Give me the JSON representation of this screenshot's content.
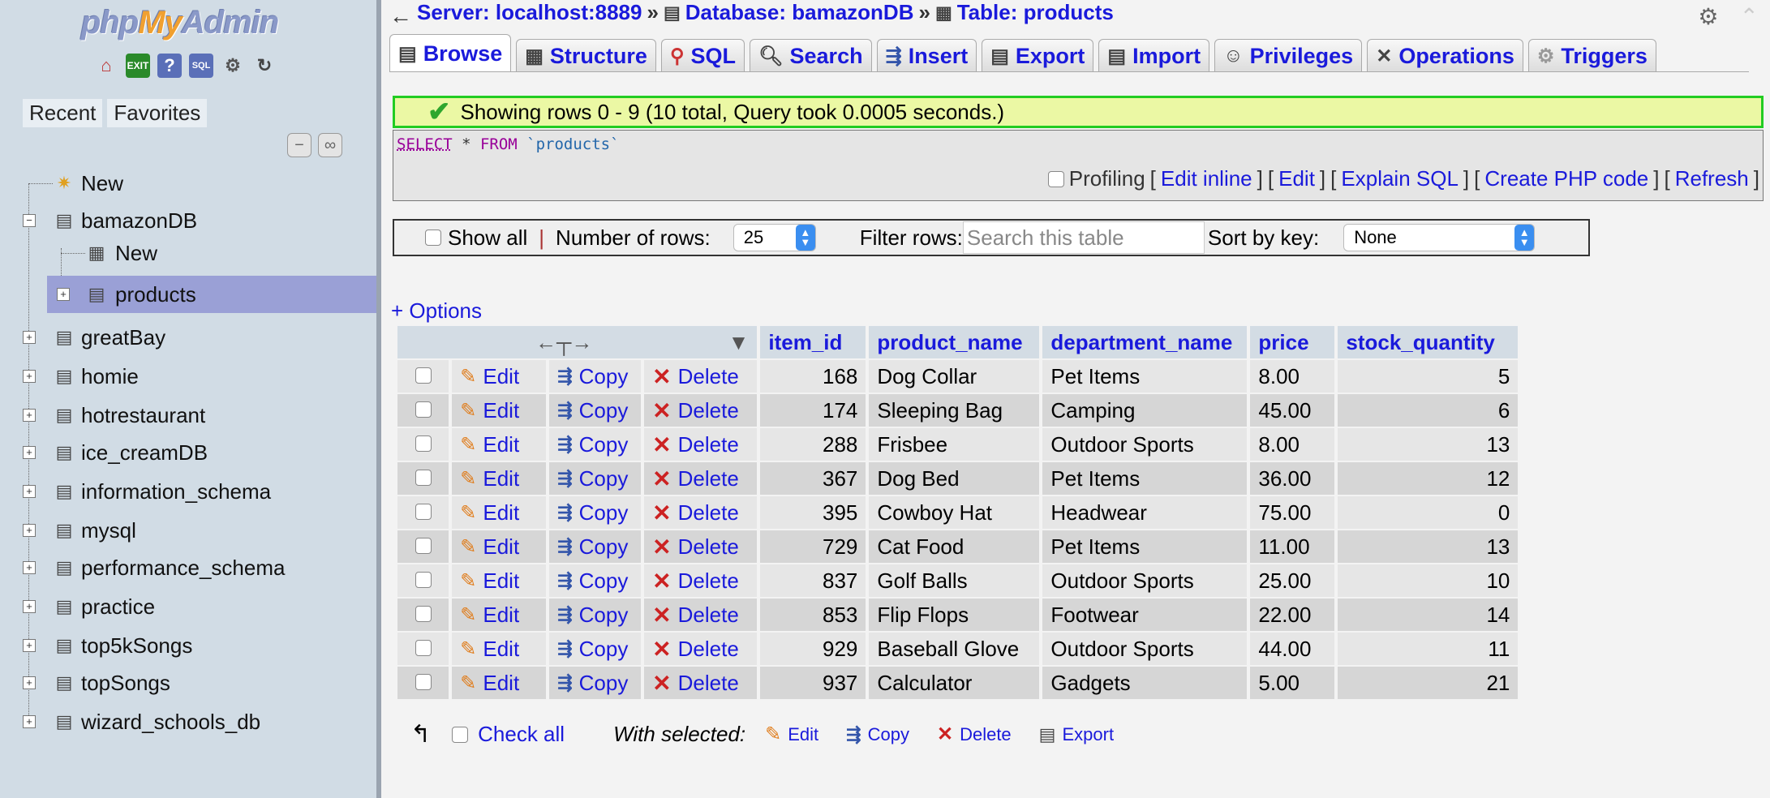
{
  "nav": {
    "logo_php": "php",
    "logo_my": "My",
    "logo_admin": "Admin",
    "tabs": [
      "Recent",
      "Favorites"
    ],
    "tree": [
      {
        "label": "New"
      },
      {
        "label": "bamazonDB"
      },
      {
        "label": "New"
      },
      {
        "label": "products"
      },
      {
        "label": "greatBay"
      },
      {
        "label": "homie"
      },
      {
        "label": "hotrestaurant"
      },
      {
        "label": "ice_creamDB"
      },
      {
        "label": "information_schema"
      },
      {
        "label": "mysql"
      },
      {
        "label": "performance_schema"
      },
      {
        "label": "practice"
      },
      {
        "label": "top5kSongs"
      },
      {
        "label": "topSongs"
      },
      {
        "label": "wizard_schools_db"
      }
    ]
  },
  "breadcrumb": {
    "server": "Server: localhost:8889",
    "database": "Database: bamazonDB",
    "table": "Table: products",
    "sep": "»"
  },
  "tabs": [
    "Browse",
    "Structure",
    "SQL",
    "Search",
    "Insert",
    "Export",
    "Import",
    "Privileges",
    "Operations",
    "Triggers"
  ],
  "message": "Showing rows 0 - 9 (10 total, Query took 0.0005 seconds.)",
  "sql": {
    "select": "SELECT",
    "star": " * ",
    "from": "FROM",
    "table": " `products`"
  },
  "sql_links": {
    "profiling": "Profiling",
    "edit_inline": "Edit inline",
    "edit": "Edit",
    "explain": "Explain SQL",
    "php": "Create PHP code",
    "refresh": "Refresh"
  },
  "navbar": {
    "show_all": "Show all",
    "sep": "|",
    "rows_label": "Number of rows:",
    "rows_value": "25",
    "filter_label": "Filter rows:",
    "filter_placeholder": "Search this table",
    "sort_label": "Sort by key:",
    "sort_value": "None"
  },
  "options": "+ Options",
  "columns": [
    "item_id",
    "product_name",
    "department_name",
    "price",
    "stock_quantity"
  ],
  "actions": {
    "edit": "Edit",
    "copy": "Copy",
    "delete": "Delete"
  },
  "rows": [
    {
      "item_id": "168",
      "product_name": "Dog Collar",
      "department_name": "Pet Items",
      "price": "8.00",
      "stock_quantity": "5"
    },
    {
      "item_id": "174",
      "product_name": "Sleeping Bag",
      "department_name": "Camping",
      "price": "45.00",
      "stock_quantity": "6"
    },
    {
      "item_id": "288",
      "product_name": "Frisbee",
      "department_name": "Outdoor Sports",
      "price": "8.00",
      "stock_quantity": "13"
    },
    {
      "item_id": "367",
      "product_name": "Dog Bed",
      "department_name": "Pet Items",
      "price": "36.00",
      "stock_quantity": "12"
    },
    {
      "item_id": "395",
      "product_name": "Cowboy Hat",
      "department_name": "Headwear",
      "price": "75.00",
      "stock_quantity": "0"
    },
    {
      "item_id": "729",
      "product_name": "Cat Food",
      "department_name": "Pet Items",
      "price": "11.00",
      "stock_quantity": "13"
    },
    {
      "item_id": "837",
      "product_name": "Golf Balls",
      "department_name": "Outdoor Sports",
      "price": "25.00",
      "stock_quantity": "10"
    },
    {
      "item_id": "853",
      "product_name": "Flip Flops",
      "department_name": "Footwear",
      "price": "22.00",
      "stock_quantity": "14"
    },
    {
      "item_id": "929",
      "product_name": "Baseball Glove",
      "department_name": "Outdoor Sports",
      "price": "44.00",
      "stock_quantity": "11"
    },
    {
      "item_id": "937",
      "product_name": "Calculator",
      "department_name": "Gadgets",
      "price": "5.00",
      "stock_quantity": "21"
    }
  ],
  "footer": {
    "check_all": "Check all",
    "with_selected": "With selected:",
    "edit": "Edit",
    "copy": "Copy",
    "delete": "Delete",
    "export": "Export"
  }
}
